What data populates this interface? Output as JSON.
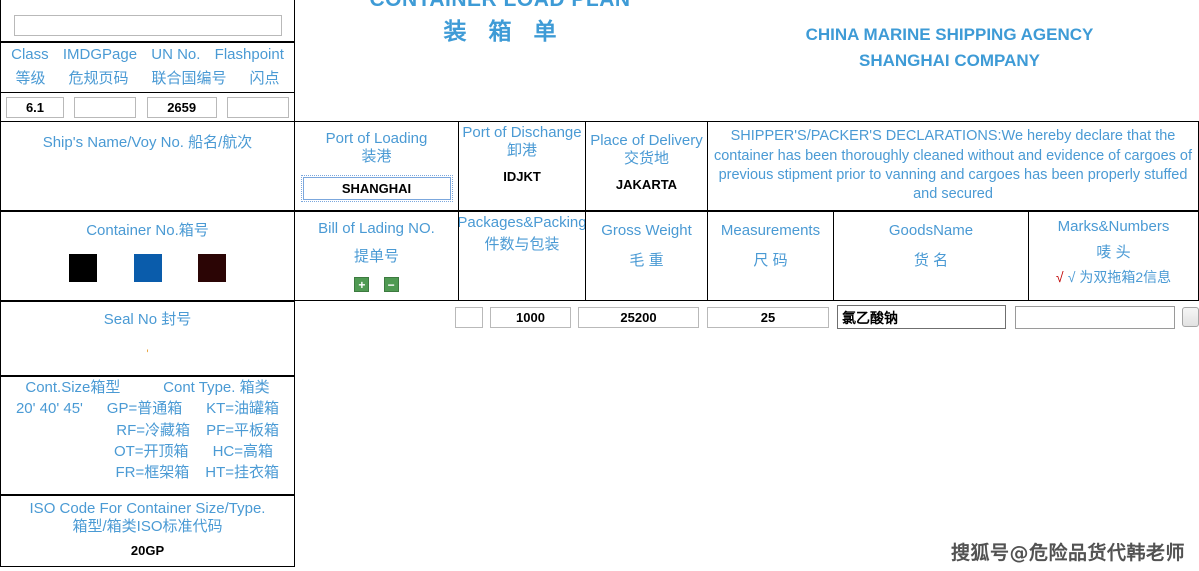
{
  "document": {
    "title_en": "CONTAINER LOAD PLAN",
    "title_cn": "装箱单",
    "company_line1": "CHINA MARINE SHIPPING AGENCY",
    "company_line2": "SHANGHAI COMPANY",
    "watermark": "搜狐号@危险品货代韩老师"
  },
  "dangerous_goods": {
    "top_input_value": "",
    "headers_en": [
      "Class",
      "IMDGPage",
      "UN No.",
      "Flashpoint"
    ],
    "headers_cn": [
      "等级",
      "危规页码",
      "联合国编号",
      "闪点"
    ],
    "values": {
      "class": "6.1",
      "imdg_page": "",
      "un_no": "2659",
      "flashpoint": ""
    }
  },
  "ship": {
    "label_en": "Ship's Name/Voy No.",
    "label_cn": "船名/航次",
    "value": ""
  },
  "container_no": {
    "label": "Container No.箱号",
    "swatches": [
      "#000000",
      "#0a5cab",
      "#2b0505"
    ]
  },
  "seal_no": {
    "label": "Seal No 封号",
    "value": "'"
  },
  "container_size": {
    "size_label_en": "Cont.Size",
    "size_label_cn": "箱型",
    "type_label_en": "Cont Type.",
    "type_label_cn": "箱类",
    "sizes": "20'  40'  45'",
    "types": [
      [
        "GP=普通箱",
        "KT=油罐箱"
      ],
      [
        "RF=冷藏箱",
        "PF=平板箱"
      ],
      [
        "OT=开顶箱",
        "HC=高箱"
      ],
      [
        "FR=框架箱",
        "HT=挂衣箱"
      ]
    ]
  },
  "iso_code": {
    "label_en": "ISO    Code For Container Size/Type.",
    "label_cn": "箱型/箱类ISO标准代码",
    "value": "20GP"
  },
  "ports": {
    "loading": {
      "label_en": "Port of Loading",
      "label_cn": "装港",
      "value": "SHANGHAI"
    },
    "discharge": {
      "label_en": "Port of Dischange",
      "label_cn": "卸港",
      "value": "IDJKT"
    },
    "delivery": {
      "label_en": "Place of Delivery",
      "label_cn": "交货地",
      "value": "JAKARTA"
    }
  },
  "declaration": {
    "text": "SHIPPER'S/PACKER'S DECLARATIONS:We hereby declare that the container has been thoroughly cleaned without and evidence of cargoes of previous stipment prior to vanning and cargoes has been properly stuffed and secured"
  },
  "cargo_table": {
    "columns": [
      {
        "label_en": "Bill of Lading NO.",
        "label_cn": "提单号",
        "add_label": "+",
        "remove_label": "−"
      },
      {
        "label_en": "Packages&Packing",
        "label_cn": "件数与包装"
      },
      {
        "label_en": "Gross Weight",
        "label_cn": "毛 重"
      },
      {
        "label_en": "Measurements",
        "label_cn": "尺 码"
      },
      {
        "label_en": "GoodsName",
        "label_cn": "货 名"
      },
      {
        "label_en": "Marks&Numbers",
        "label_cn": "唛 头",
        "note": "√ 为双拖箱2信息"
      }
    ],
    "row": {
      "bl_no": "",
      "packages_unit": "",
      "packages": "1000",
      "gross_weight": "25200",
      "measurements": "25",
      "goods_name": "氯乙酸钠",
      "marks": ""
    }
  }
}
